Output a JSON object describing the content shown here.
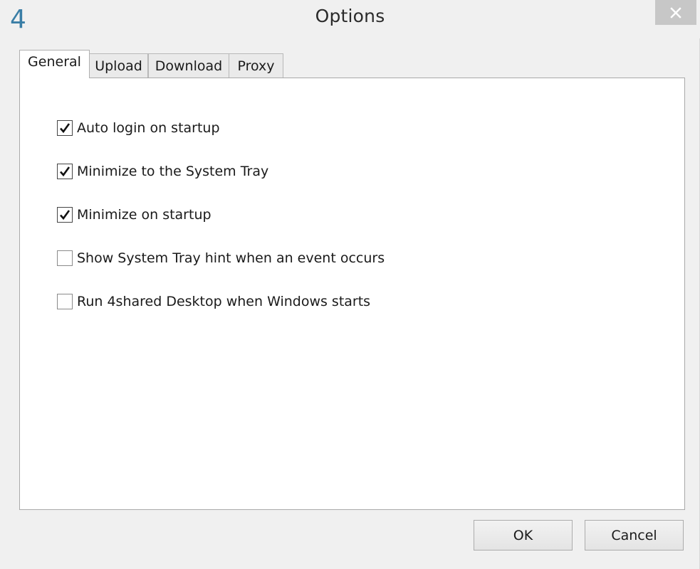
{
  "window": {
    "title": "Options",
    "logo_text": "4",
    "logo_color": "#3a7ea6"
  },
  "tabs": [
    {
      "label": "General",
      "active": true
    },
    {
      "label": "Upload",
      "active": false
    },
    {
      "label": "Download",
      "active": false
    },
    {
      "label": "Proxy",
      "active": false
    }
  ],
  "general": {
    "options": [
      {
        "label": "Auto login on startup",
        "checked": true
      },
      {
        "label": "Minimize to the System Tray",
        "checked": true
      },
      {
        "label": "Minimize on startup",
        "checked": true
      },
      {
        "label": "Show System Tray hint when an event occurs",
        "checked": false
      },
      {
        "label": "Run 4shared Desktop when Windows starts",
        "checked": false
      }
    ]
  },
  "buttons": {
    "ok_label": "OK",
    "cancel_label": "Cancel"
  },
  "icons": {
    "close": "close-icon",
    "check": "checkmark-icon"
  }
}
